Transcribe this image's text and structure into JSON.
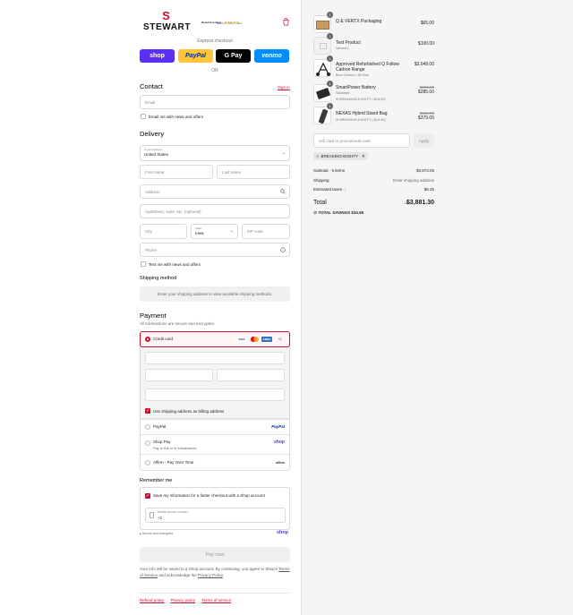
{
  "header": {
    "brand": "STEWART",
    "rating_label": "Rated Excellent",
    "rating_stars": "★★★★★",
    "rating_sub": "Based on 1,000+ reviews"
  },
  "express": {
    "label": "Express checkout",
    "buttons": [
      {
        "label": "shop",
        "bg": "#5a31f4",
        "fg": "#ffffff"
      },
      {
        "label": "PayPal",
        "bg": "#ffc439",
        "fg": "#003087"
      },
      {
        "label": "G Pay",
        "bg": "#000000",
        "fg": "#ffffff"
      },
      {
        "label": "venmo",
        "bg": "#008cff",
        "fg": "#ffffff"
      }
    ],
    "or_label": "OR"
  },
  "contact": {
    "title": "Contact",
    "signin": "Sign in",
    "email_placeholder": "Email",
    "news_label": "Email me with news and offers"
  },
  "delivery": {
    "title": "Delivery",
    "country_label": "Country/Region",
    "country_value": "United States",
    "first_name": "First name",
    "last_name": "Last name",
    "address": "Address",
    "apartment": "Apartment, suite, etc. (optional)",
    "city": "City",
    "state_label": "State",
    "state_value": "Iowa",
    "zip": "ZIP code",
    "phone": "Phone",
    "text_label": "Text me with news and offers"
  },
  "shipping": {
    "title": "Shipping method",
    "message": "Enter your shipping address to view available shipping methods."
  },
  "payment": {
    "title": "Payment",
    "subtitle": "All transactions are secure and encrypted.",
    "credit_card": "Credit card",
    "more_cards": "+5",
    "billing_label": "Use shipping address as billing address",
    "paypal": "PayPal",
    "shoppay": "Shop Pay",
    "shoppay_sub": "Pay in full or in installments",
    "shoppay_logo": "shop",
    "affirm": "Affirm - Pay Over Time",
    "affirm_logo": "affirm",
    "paypal_logo": "PayPal"
  },
  "remember": {
    "title": "Remember me",
    "save_label": "Save my information for a faster checkout with a Shop account",
    "phone_label": "Mobile phone number",
    "phone_value": "+1",
    "secure": "Secure and encrypted",
    "shop_logo": "shop"
  },
  "paynow": "Pay now",
  "disclaimer": {
    "text1": "Your info will be saved to a Shop account. By continuing, you agree to Shop's ",
    "terms": "Terms of Service",
    "text2": " and acknowledge the ",
    "privacy": "Privacy Policy",
    "text3": "."
  },
  "footer": {
    "links": [
      "Refund policy",
      "Privacy policy",
      "Terms of service"
    ]
  },
  "items": [
    {
      "qty": "1",
      "name": "Q & VERTX Packaging",
      "sub": "",
      "discount": "",
      "price": "$65.00",
      "old_price": ""
    },
    {
      "qty": "1",
      "name": "Test Product",
      "sub": "Variant 1",
      "discount": "",
      "price": "$100.00",
      "old_price": ""
    },
    {
      "qty": "1",
      "name": "Approved Refurbished Q Follow Carbon Range",
      "sub": "Blue Carbon / 38 Hole",
      "discount": "",
      "price": "$3,049.00",
      "old_price": ""
    },
    {
      "qty": "1",
      "name": "SmartPower Battery",
      "sub": "Standard",
      "discount": "BREAKING-EIGHTY (-$15.00)",
      "price": "$285.00",
      "old_price": "$300.00"
    },
    {
      "qty": "1",
      "name": "NEXAS Hybrid Stand Bag",
      "sub": "",
      "discount": "BREAKING-EIGHTY (-$19.95)",
      "price": "$379.05",
      "old_price": "$399.00"
    }
  ],
  "gift": {
    "placeholder": "Gift card or promotional code",
    "apply": "Apply",
    "chip": "BREAKING-EIGHTY"
  },
  "summary": {
    "subtotal_label": "Subtotal · 5 items",
    "subtotal": "$3,873.05",
    "shipping_label": "Shipping",
    "shipping": "Enter shipping address",
    "taxes_label": "Estimated taxes",
    "taxes": "$8.25",
    "total_label": "Total",
    "currency": "USD",
    "total": "$3,881.30",
    "savings_label": "TOTAL SAVINGS",
    "savings": "$34.95"
  },
  "colors": {
    "accent": "#c8102e",
    "sidebar_bg": "#f5f5f5"
  }
}
